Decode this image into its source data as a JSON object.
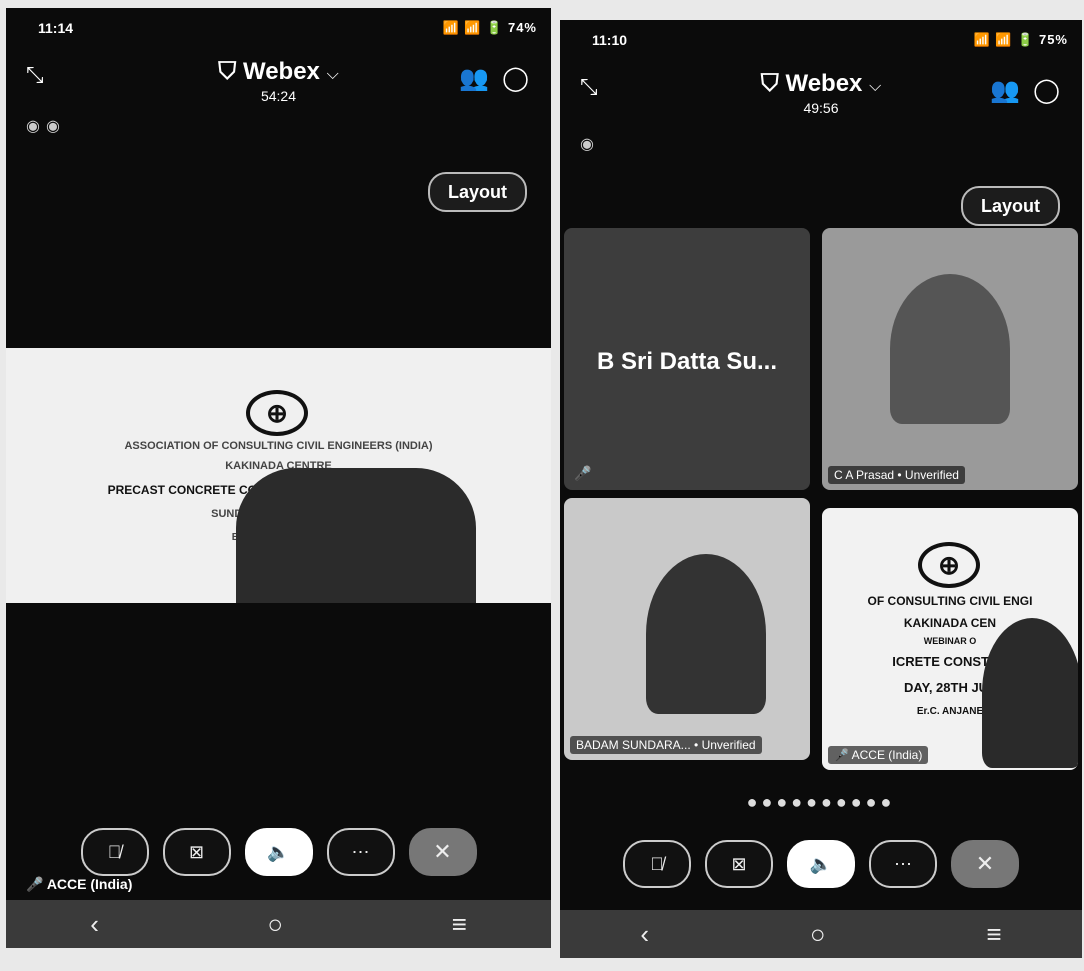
{
  "left": {
    "status_time": "11:14",
    "status_icons": "📶 📶 🔋 74%",
    "app_title": "Webex",
    "timer": "54:24",
    "layout_label": "Layout",
    "slide_lines": [
      "ASSOCIATION OF CONSULTING CIVIL ENGINEERS (INDIA)",
      "KAKINADA CENTRE",
      "PRECAST CONCRETE CONSTRUCTION & SUSTAINABILITY",
      "SUNDAY, 28TH JULY 2024",
      "Er.C. ANJANEYULU"
    ],
    "self_label": "ACCE (India)"
  },
  "right": {
    "status_time": "11:10",
    "status_icons": "📶 📶 🔋 75%",
    "app_title": "Webex",
    "timer": "49:56",
    "layout_label": "Layout",
    "tile1_name": "B Sri Datta Su...",
    "tile2_name": "C A Prasad",
    "tile2_status": "• Unverified",
    "tile3_name": "BADAM SUNDARA...",
    "tile3_status": "• Unverified",
    "tile4_name": "ACCE (India)",
    "tile4_lines": [
      "OF CONSULTING CIVIL ENGI",
      "KAKINADA CEN",
      "WEBINAR O",
      "ICRETE CONSTRU",
      "DAY, 28TH JUL",
      "Er.C. ANJANE"
    ]
  },
  "icons": {
    "collapse": "collapse-icon",
    "participants": "participants-icon",
    "chat": "chat-icon",
    "mute": "microphone-muted-icon",
    "video": "video-off-icon",
    "speaker": "speaker-icon",
    "more": "more-icon",
    "leave": "close-icon"
  }
}
